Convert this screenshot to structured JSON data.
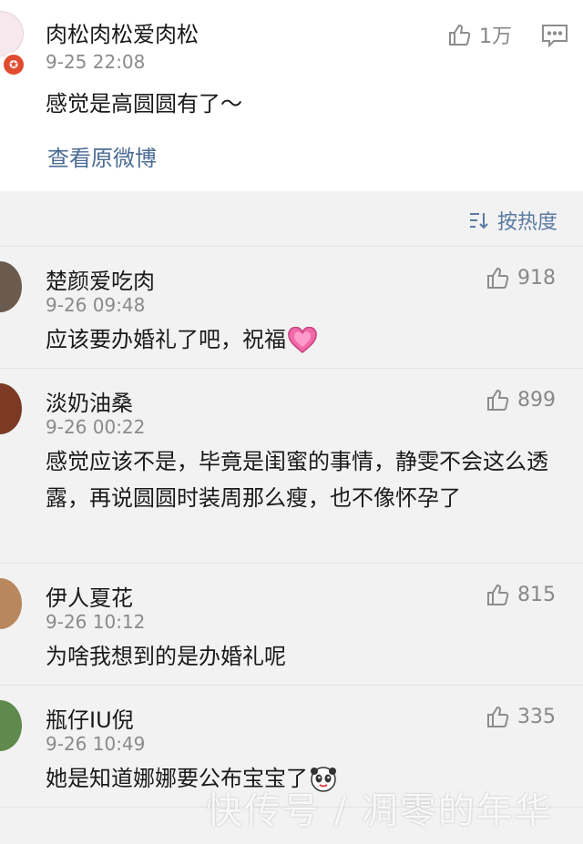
{
  "post": {
    "username": "肉松肉松爱肉松",
    "time": "9-25 22:08",
    "text": "感觉是高圆圆有了～",
    "likes": "1万",
    "view_original": "查看原微博"
  },
  "sort_label": "按热度",
  "comments": [
    {
      "username": "楚颜爱吃肉",
      "time": "9-26 09:48",
      "text": "应该要办婚礼了吧，祝福",
      "likes": "918"
    },
    {
      "username": "淡奶油桑",
      "time": "9-26 00:22",
      "text": "感觉应该不是，毕竟是闺蜜的事情，静雯不会这么透露，再说圆圆时装周那么瘦，也不像怀孕了",
      "likes": "899"
    },
    {
      "username": "伊人夏花",
      "time": "9-26 10:12",
      "text": "为啥我想到的是办婚礼呢",
      "likes": "815"
    },
    {
      "username": "瓶仔IU倪",
      "time": "9-26 10:49",
      "text": "她是知道娜娜要公布宝宝了",
      "likes": "335"
    }
  ],
  "watermark": "快传号 / 凋零的年华",
  "colors": {
    "link": "#4a6b94",
    "sort": "#5a7aa3",
    "badge": "#e24b2f"
  }
}
